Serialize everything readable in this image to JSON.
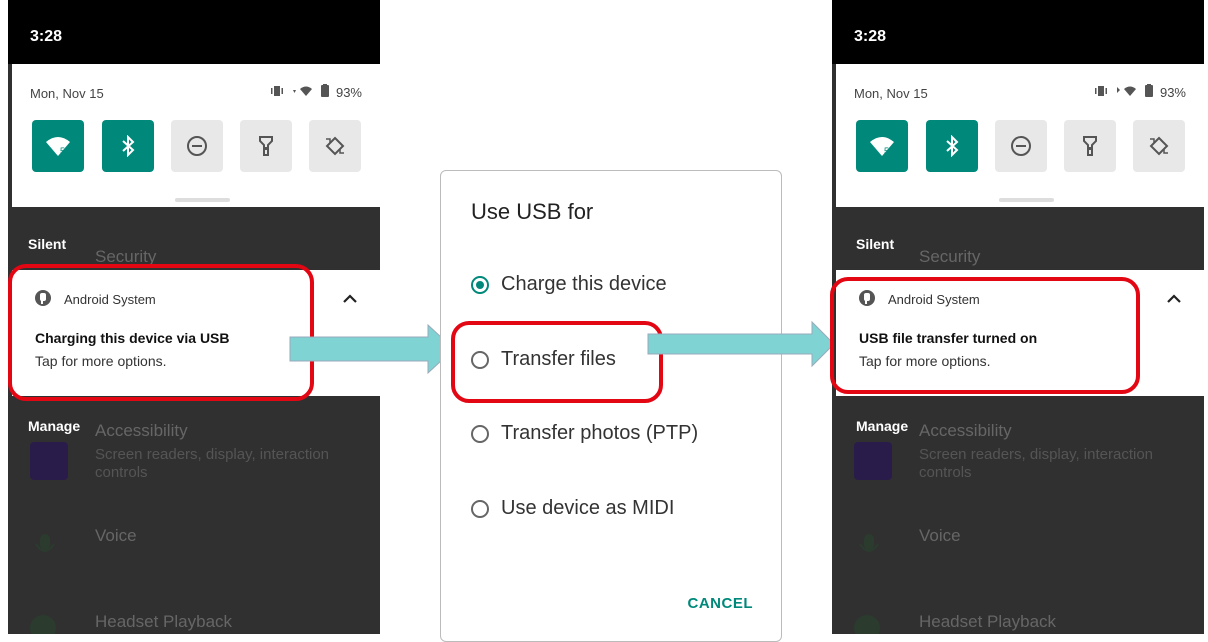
{
  "left": {
    "time": "3:28",
    "date": "Mon, Nov 15",
    "battery": "93%",
    "behind_items": [
      "Security",
      "Accessibility",
      "Screen readers, display, interaction",
      "controls",
      "Voice",
      "Headset Playback"
    ],
    "section_silent": "Silent",
    "section_manage": "Manage",
    "notif": {
      "app": "Android System",
      "title": "Charging this device via USB",
      "text": "Tap for more options."
    }
  },
  "dialog": {
    "title": "Use USB for",
    "options": [
      "Charge this device",
      "Transfer files",
      "Transfer photos (PTP)",
      "Use device as MIDI"
    ],
    "selected": "Charge this device",
    "cancel": "CANCEL"
  },
  "right": {
    "time": "3:28",
    "date": "Mon, Nov 15",
    "battery": "93%",
    "behind_items": [
      "Security",
      "Accessibility",
      "Screen readers, display, interaction",
      "controls",
      "Voice",
      "Headset Playback"
    ],
    "section_silent": "Silent",
    "section_manage": "Manage",
    "notif": {
      "app": "Android System",
      "title": "USB file transfer turned on",
      "text": "Tap for more options."
    }
  },
  "colors": {
    "accent": "#00897b",
    "highlight": "#e30613",
    "arrow": "#7fd3d3"
  }
}
